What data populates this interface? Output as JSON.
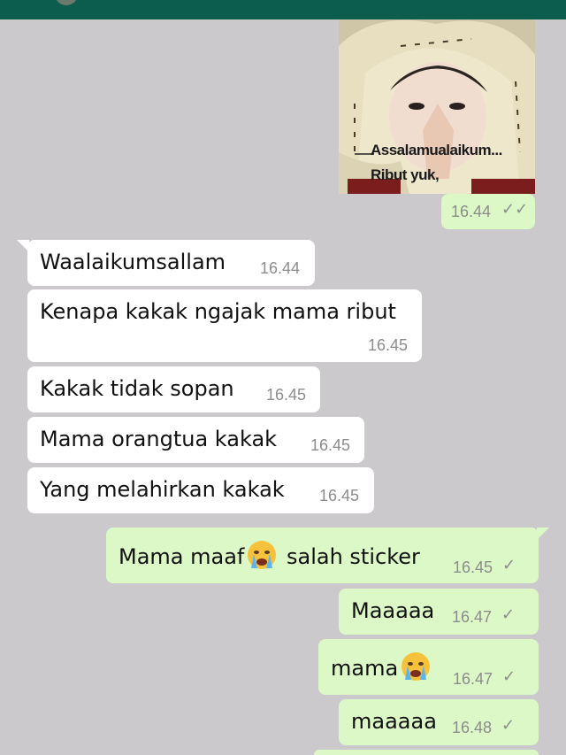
{
  "chat": {
    "sticker": {
      "caption_line1": "Assalamualaikum...",
      "caption_line2": "Ribut yuk,",
      "time": "16.44",
      "status": "read"
    },
    "messages": [
      {
        "text": "Waalaikumsallam",
        "time": "16.44",
        "direction": "incoming"
      },
      {
        "text": "Kenapa kakak ngajak mama ribut",
        "time": "16.45",
        "direction": "incoming"
      },
      {
        "text": "Kakak tidak sopan",
        "time": "16.45",
        "direction": "incoming"
      },
      {
        "text": "Mama orangtua kakak",
        "time": "16.45",
        "direction": "incoming"
      },
      {
        "text": "Yang melahirkan kakak",
        "time": "16.45",
        "direction": "incoming"
      },
      {
        "text_before": "Mama maaf",
        "emoji": "crying-face",
        "text_after": " salah sticker",
        "time": "16.45",
        "direction": "outgoing",
        "status": "sent"
      },
      {
        "text": "Maaaaa",
        "time": "16.47",
        "direction": "outgoing",
        "status": "sent"
      },
      {
        "text_before": "mama",
        "emoji": "crying-face",
        "time": "16.47",
        "direction": "outgoing",
        "status": "sent"
      },
      {
        "text": "maaaaa",
        "time": "16.48",
        "direction": "outgoing",
        "status": "sent"
      }
    ]
  },
  "icons": {
    "read_receipt": "double-check-icon",
    "sent_receipt": "single-check-icon"
  },
  "colors": {
    "background": "#ccc9cd",
    "header": "#0d5d4f",
    "incoming_bubble": "#ffffff",
    "outgoing_bubble": "#dcf8c6",
    "timestamp": "#8c8c8c"
  }
}
